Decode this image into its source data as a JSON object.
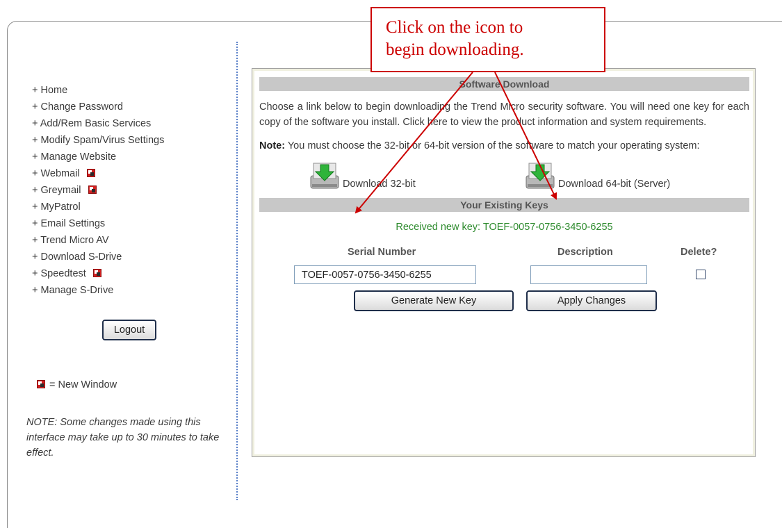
{
  "sidebar": {
    "items": [
      {
        "label": "+ Home",
        "new_window": false
      },
      {
        "label": "+ Change Password",
        "new_window": false
      },
      {
        "label": "+ Add/Rem Basic Services",
        "new_window": false
      },
      {
        "label": "+ Modify Spam/Virus Settings",
        "new_window": false
      },
      {
        "label": "+ Manage Website",
        "new_window": false
      },
      {
        "label": "+ Webmail",
        "new_window": true
      },
      {
        "label": "+ Greymail",
        "new_window": true
      },
      {
        "label": "+ MyPatrol",
        "new_window": false
      },
      {
        "label": "+ Email Settings",
        "new_window": false
      },
      {
        "label": "+ Trend Micro AV",
        "new_window": false
      },
      {
        "label": "+ Download S-Drive",
        "new_window": false
      },
      {
        "label": "+ Speedtest",
        "new_window": true
      },
      {
        "label": "+ Manage S-Drive",
        "new_window": false
      }
    ],
    "logout_label": "Logout",
    "legend_text": "= New Window",
    "note": "NOTE: Some changes made using this interface may take up to 30 minutes to take effect."
  },
  "download_section": {
    "title": "Software Download",
    "intro": "Choose a link below to begin downloading the Trend Micro security software. You will need one key for each copy of the software you install. Click here to view the product information and system requirements.",
    "note_label": "Note:",
    "note_text": " You must choose the 32-bit or 64-bit version of the software to match your operating system:",
    "download_32_label": "Download 32-bit",
    "download_64_label": "Download 64-bit (Server)",
    "icon": "download-drive-icon"
  },
  "keys_section": {
    "title": "Your Existing Keys",
    "received_message": "Received new key: TOEF-0057-0756-3450-6255",
    "col_serial": "Serial Number",
    "col_description": "Description",
    "col_delete": "Delete?",
    "serial_value": "TOEF-0057-0756-3450-6255",
    "description_value": "",
    "generate_label": "Generate New Key",
    "apply_label": "Apply Changes"
  },
  "callout": {
    "line1": "Click on the icon to",
    "line2": "begin downloading."
  },
  "colors": {
    "callout_red": "#cc0000",
    "success_green": "#2e8b2e",
    "section_bar": "#c8c8c8",
    "divider_blue": "#5a80c8"
  }
}
